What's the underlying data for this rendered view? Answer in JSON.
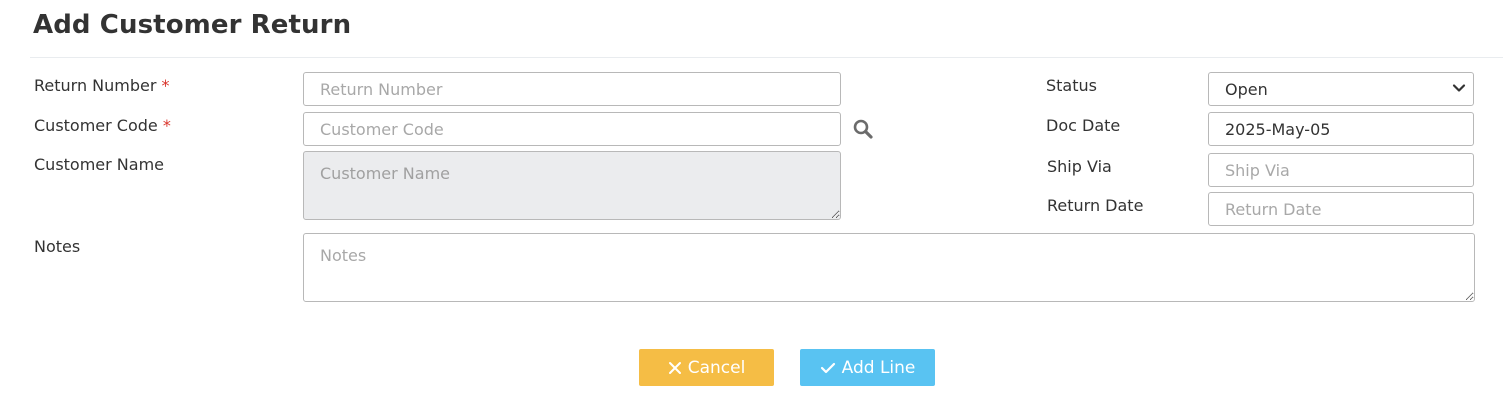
{
  "page": {
    "title": "Add Customer Return"
  },
  "form": {
    "return_number": {
      "label": "Return Number",
      "required_mark": "*",
      "placeholder": "Return Number",
      "value": ""
    },
    "customer_code": {
      "label": "Customer Code",
      "required_mark": "*",
      "placeholder": "Customer Code",
      "value": ""
    },
    "customer_name": {
      "label": "Customer Name",
      "placeholder": "Customer Name",
      "value": ""
    },
    "notes": {
      "label": "Notes",
      "placeholder": "Notes",
      "value": ""
    },
    "status": {
      "label": "Status",
      "value": "Open",
      "options": [
        "Open"
      ]
    },
    "doc_date": {
      "label": "Doc Date",
      "value": "2025-May-05",
      "placeholder": "Doc Date"
    },
    "ship_via": {
      "label": "Ship Via",
      "placeholder": "Ship Via",
      "value": ""
    },
    "return_date": {
      "label": "Return Date",
      "placeholder": "Return Date",
      "value": ""
    }
  },
  "actions": {
    "cancel_label": "Cancel",
    "add_line_label": "Add Line"
  },
  "icons": {
    "search": "search-icon",
    "cancel": "close-icon",
    "add_line": "check-icon",
    "status_dropdown": "chevron-down-icon"
  },
  "colors": {
    "cancel_button": "#f5bd45",
    "add_line_button": "#59c3f2",
    "required_mark": "#d9342b",
    "disabled_field": "#ebecee"
  }
}
